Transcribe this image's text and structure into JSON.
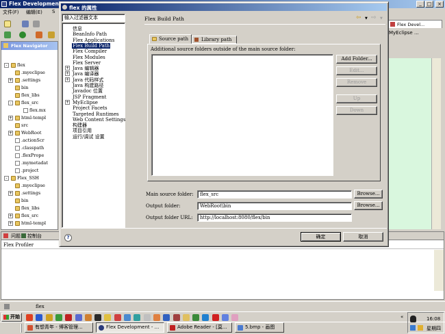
{
  "eclipse": {
    "title": "Flex Development",
    "menu": [
      "文件(F)",
      "编辑(E)",
      "S"
    ],
    "navigator_title": "Flex Navigator",
    "right_tab": "Flex Devel...",
    "right_tab2": "MyEclipse ...",
    "tree": [
      {
        "label": "flex",
        "level": 0,
        "kind": "project",
        "expander": "−"
      },
      {
        "label": ".myeclipse",
        "level": 1,
        "kind": "folder",
        "expander": ""
      },
      {
        "label": ".settings",
        "level": 1,
        "kind": "folder",
        "expander": "+"
      },
      {
        "label": "bin",
        "level": 1,
        "kind": "folder",
        "expander": ""
      },
      {
        "label": "flex_libs",
        "level": 1,
        "kind": "folder",
        "expander": ""
      },
      {
        "label": "flex_src",
        "level": 1,
        "kind": "folder",
        "expander": "−"
      },
      {
        "label": "flex.mx",
        "level": 2,
        "kind": "file",
        "expander": ""
      },
      {
        "label": "html-templ",
        "level": 1,
        "kind": "folder",
        "expander": "+"
      },
      {
        "label": "src",
        "level": 1,
        "kind": "folder",
        "expander": ""
      },
      {
        "label": "WebRoot",
        "level": 1,
        "kind": "folder",
        "expander": "+"
      },
      {
        "label": ".actionScr",
        "level": 1,
        "kind": "file",
        "expander": ""
      },
      {
        "label": ".classpath",
        "level": 1,
        "kind": "file",
        "expander": ""
      },
      {
        "label": ".flexPrope",
        "level": 1,
        "kind": "file",
        "expander": ""
      },
      {
        "label": ".mymetadat",
        "level": 1,
        "kind": "file",
        "expander": ""
      },
      {
        "label": ".project",
        "level": 1,
        "kind": "file",
        "expander": ""
      },
      {
        "label": "Flex_SSH",
        "level": 0,
        "kind": "project",
        "expander": "−"
      },
      {
        "label": ".myeclipse",
        "level": 1,
        "kind": "folder",
        "expander": ""
      },
      {
        "label": ".settings",
        "level": 1,
        "kind": "folder",
        "expander": "+"
      },
      {
        "label": "bin",
        "level": 1,
        "kind": "folder",
        "expander": ""
      },
      {
        "label": "flex_libs",
        "level": 1,
        "kind": "folder",
        "expander": ""
      },
      {
        "label": "flex_src",
        "level": 1,
        "kind": "folder",
        "expander": "+"
      },
      {
        "label": "html-templ",
        "level": 1,
        "kind": "folder",
        "expander": "+"
      }
    ],
    "bottom_tabs": [
      "问题",
      "控制台"
    ],
    "bottom_panel_title": "Flex Profiler",
    "status_text": "flex"
  },
  "dialog": {
    "title": "flex 的属性",
    "filter_placeholder": "输入过滤器文本",
    "categories": [
      {
        "label": "信息",
        "expander": ""
      },
      {
        "label": "BeanInfo Path",
        "expander": ""
      },
      {
        "label": "Flex Applications",
        "expander": ""
      },
      {
        "label": "Flex Build Path",
        "expander": "",
        "selected": true
      },
      {
        "label": "Flex Compiler",
        "expander": ""
      },
      {
        "label": "Flex Modules",
        "expander": ""
      },
      {
        "label": "Flex Server",
        "expander": ""
      },
      {
        "label": "Java 编辑器",
        "expander": "+"
      },
      {
        "label": "Java 编译器",
        "expander": "+"
      },
      {
        "label": "Java 代码样式",
        "expander": "+"
      },
      {
        "label": "Java 构建路径",
        "expander": ""
      },
      {
        "label": "Javadoc 位置",
        "expander": ""
      },
      {
        "label": "JSP Fragment",
        "expander": ""
      },
      {
        "label": "MyEclipse",
        "expander": "+"
      },
      {
        "label": "Project Facets",
        "expander": ""
      },
      {
        "label": "Targeted Runtimes",
        "expander": ""
      },
      {
        "label": "Web Content Settings",
        "expander": ""
      },
      {
        "label": "构建器",
        "expander": ""
      },
      {
        "label": "项目引用",
        "expander": ""
      },
      {
        "label": "运行/调试 设置",
        "expander": ""
      }
    ],
    "page_title": "Flex Build Path",
    "tabs": [
      "Source path",
      "Library path"
    ],
    "source_desc": "Additional source folders outside of the main source folder:",
    "side_buttons": [
      {
        "label": "Add Folder...",
        "enabled": true
      },
      {
        "label": "Edit...",
        "enabled": false
      },
      {
        "label": "Remove",
        "enabled": false
      },
      {
        "label": "Up",
        "enabled": false
      },
      {
        "label": "Down",
        "enabled": false
      }
    ],
    "fields": {
      "main_source_label": "Main source folder:",
      "main_source_value": "flex_src",
      "output_label": "Output folder:",
      "output_value": "WebRoot\\bin",
      "output_url_label": "Output folder URL:",
      "output_url_value": "http://localhost:8080/flex/bin",
      "browse1": "Browse...",
      "browse2": "Browse..."
    },
    "ok": "确定",
    "cancel": "取消",
    "help": "?"
  },
  "taskbar": {
    "start": "开始",
    "tasks": [
      "有想青年 - 博客管理...",
      "Flex Development - ...",
      "Adobe Reader - [莫...",
      "5.bmp - 画图"
    ],
    "clock_time": "16:08",
    "clock_day": "星期四",
    "colors": {
      "active_title": "#0a246a",
      "selection": "#0a246a",
      "editor_bg": "#d9f7de"
    }
  }
}
